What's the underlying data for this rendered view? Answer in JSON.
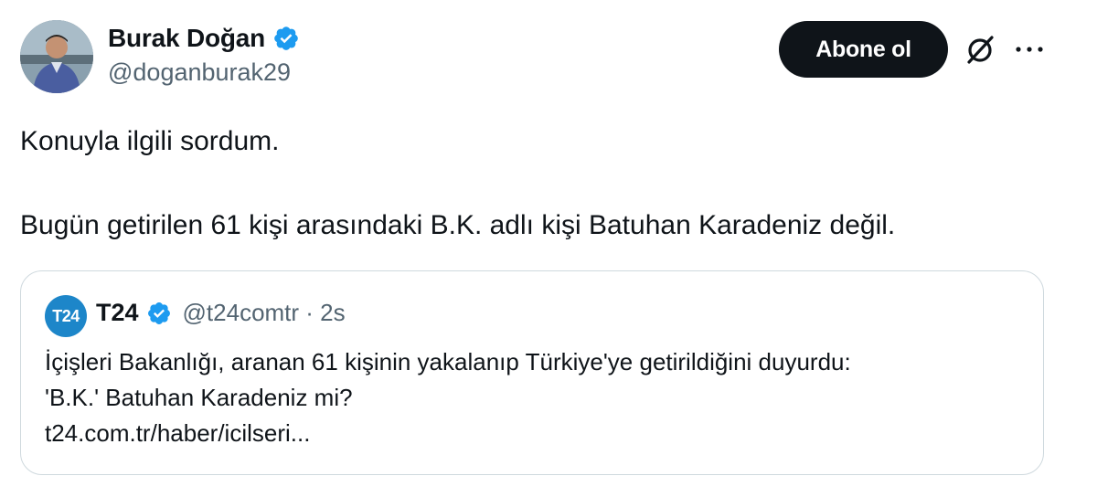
{
  "author": {
    "name": "Burak Doğan",
    "handle": "@doganburak29",
    "verified_color": "#1d9bf0"
  },
  "actions": {
    "subscribe_label": "Abone ol",
    "grok_icon": "grok-icon",
    "more_icon": "more-icon"
  },
  "tweet": {
    "lines": [
      "Konuyla ilgili sordum.",
      "Bugün getirilen 61 kişi arasındaki B.K. adlı kişi Batuhan Karadeniz değil."
    ]
  },
  "quote": {
    "avatar_text": "T24",
    "avatar_color": "#1d86c9",
    "name": "T24",
    "meta": "@t24comtr · 2s",
    "lines": [
      "İçişleri Bakanlığı, aranan 61 kişinin yakalanıp Türkiye'ye getirildiğini duyurdu:",
      "'B.K.' Batuhan Karadeniz mi?",
      "t24.com.tr/haber/icilseri..."
    ]
  }
}
